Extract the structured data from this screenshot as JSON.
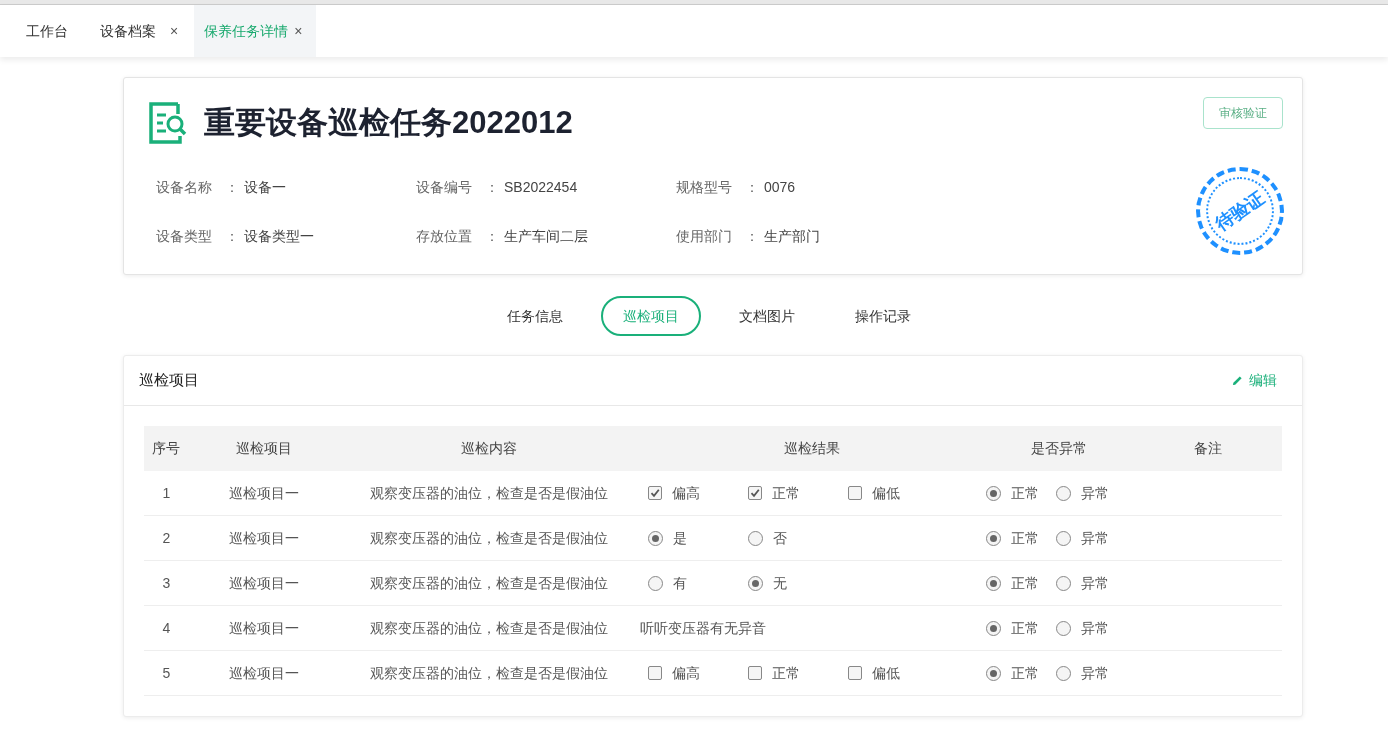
{
  "tabs": [
    {
      "label": "工作台",
      "selected": false
    },
    {
      "label": "设备档案",
      "selected": false,
      "close": "×"
    },
    {
      "label": "保养任务详情",
      "selected": true,
      "close": "×"
    }
  ],
  "header": {
    "title": "重要设备巡检任务2022012",
    "action": "审核验证",
    "stamp": "待验证",
    "fields": [
      {
        "label": "设备名称",
        "colon": "：",
        "value": "设备一"
      },
      {
        "label": "设备编号",
        "colon": "：",
        "value": "SB2022454"
      },
      {
        "label": "规格型号",
        "colon": "：",
        "value": "0076"
      },
      {
        "label": "设备类型",
        "colon": "：",
        "value": "设备类型一"
      },
      {
        "label": "存放位置",
        "colon": "：",
        "value": "生产车间二层"
      },
      {
        "label": "使用部门",
        "colon": "：",
        "value": "生产部门"
      }
    ]
  },
  "section_tabs": [
    {
      "label": "任务信息",
      "selected": false
    },
    {
      "label": "巡检项目",
      "selected": true
    },
    {
      "label": "文档图片",
      "selected": false
    },
    {
      "label": "操作记录",
      "selected": false
    }
  ],
  "panel": {
    "title": "巡检项目",
    "edit": "编辑"
  },
  "table": {
    "columns": [
      "序号",
      "巡检项目",
      "巡检内容",
      "巡检结果",
      "是否异常",
      "备注"
    ],
    "rows": [
      {
        "no": "1",
        "item": "巡检项目一",
        "content": "观察变压器的油位，检查是否是假油位",
        "result": {
          "kind": "checkbox",
          "options": [
            {
              "label": "偏高",
              "checked": true
            },
            {
              "label": "正常",
              "checked": true
            },
            {
              "label": "偏低",
              "checked": false
            }
          ]
        },
        "abnormal": [
          {
            "label": "正常",
            "selected": true
          },
          {
            "label": "异常",
            "selected": false
          }
        ]
      },
      {
        "no": "2",
        "item": "巡检项目一",
        "content": "观察变压器的油位，检查是否是假油位",
        "result": {
          "kind": "radio",
          "options": [
            {
              "label": "是",
              "checked": true
            },
            {
              "label": "否",
              "checked": false
            }
          ]
        },
        "abnormal": [
          {
            "label": "正常",
            "selected": true
          },
          {
            "label": "异常",
            "selected": false
          }
        ]
      },
      {
        "no": "3",
        "item": "巡检项目一",
        "content": "观察变压器的油位，检查是否是假油位",
        "result": {
          "kind": "radio",
          "options": [
            {
              "label": "有",
              "checked": false
            },
            {
              "label": "无",
              "checked": true
            }
          ]
        },
        "abnormal": [
          {
            "label": "正常",
            "selected": true
          },
          {
            "label": "异常",
            "selected": false
          }
        ]
      },
      {
        "no": "4",
        "item": "巡检项目一",
        "content": "观察变压器的油位，检查是否是假油位",
        "result": {
          "kind": "text",
          "text": "听听变压器有无异音"
        },
        "abnormal": [
          {
            "label": "正常",
            "selected": true
          },
          {
            "label": "异常",
            "selected": false
          }
        ]
      },
      {
        "no": "5",
        "item": "巡检项目一",
        "content": "观察变压器的油位，检查是否是假油位",
        "result": {
          "kind": "checkbox",
          "options": [
            {
              "label": "偏高",
              "checked": false
            },
            {
              "label": "正常",
              "checked": false
            },
            {
              "label": "偏低",
              "checked": false
            }
          ]
        },
        "abnormal": [
          {
            "label": "正常",
            "selected": true
          },
          {
            "label": "异常",
            "selected": false
          }
        ]
      }
    ]
  }
}
